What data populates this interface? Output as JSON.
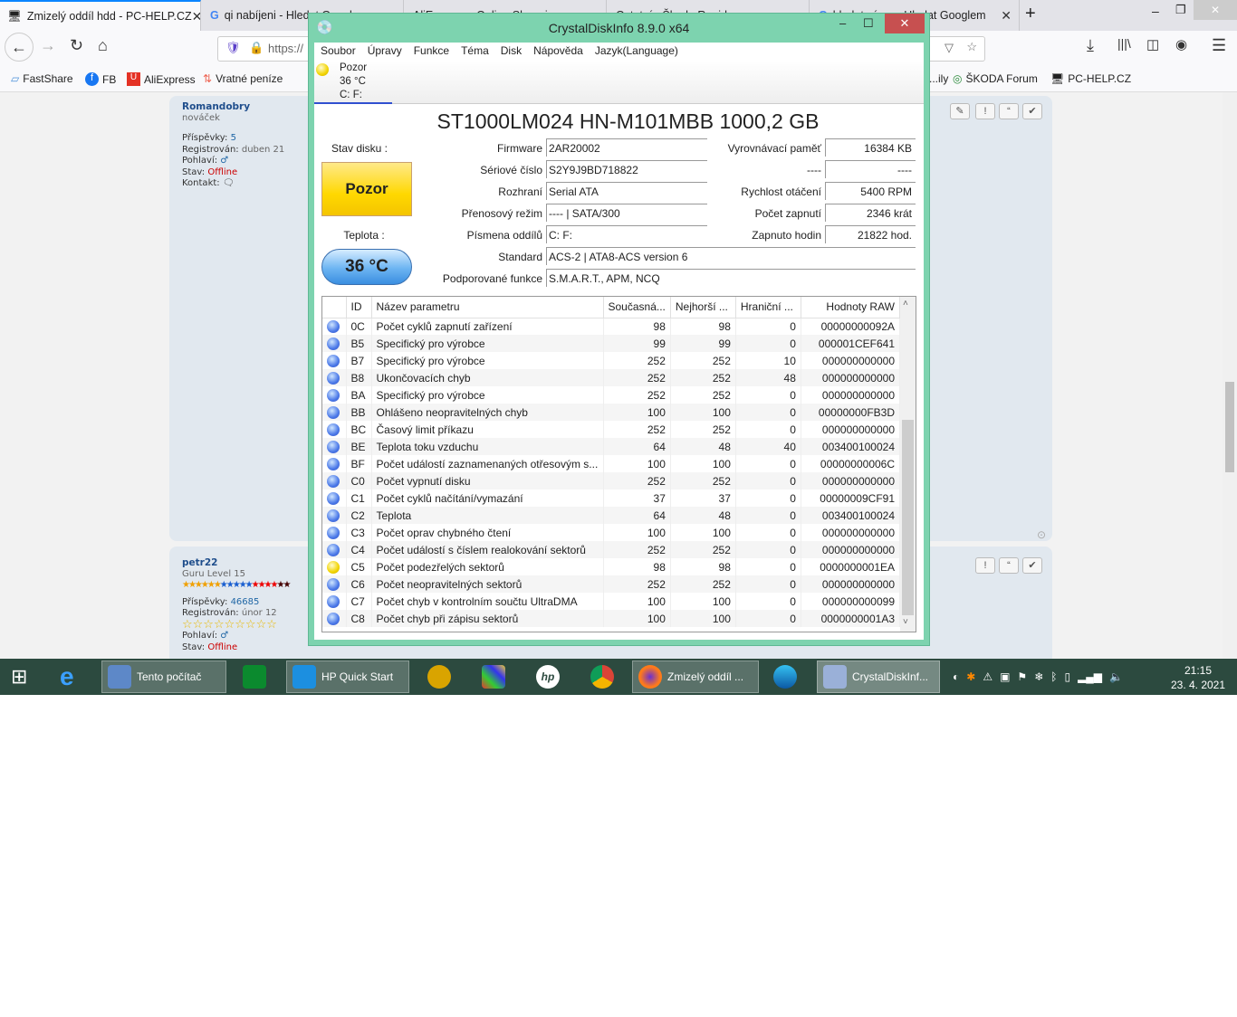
{
  "browser": {
    "tabs": [
      {
        "label": "Zmizelý oddíl hdd - PC-HELP.CZ",
        "active": true
      },
      {
        "label": "qi nabíjeni - Hledat Googlem"
      },
      {
        "label": "AliExpress - Online Shopping"
      },
      {
        "label": "Ostatní - Škoda Rapid"
      },
      {
        "label": "hledat výraz - Hledat Googlem"
      }
    ],
    "url": "https://",
    "bookmarks": [
      "FastShare",
      "FB",
      "AliExpress",
      "Vratné peníze",
      "...ily",
      "ŠKODA Forum",
      "PC-HELP.CZ"
    ]
  },
  "forum": {
    "posts": [
      {
        "user": "Romandobry",
        "rank": "nováček",
        "posts_label": "Příspěvky:",
        "posts": "5",
        "reg_label": "Registrován:",
        "reg": "duben 21",
        "gender_label": "Pohlaví:",
        "status_label": "Stav:",
        "status": "Offline",
        "contact_label": "Kontakt:"
      },
      {
        "user": "petr22",
        "rank": "Guru Level 15",
        "posts_label": "Příspěvky:",
        "posts": "46685",
        "reg_label": "Registrován:",
        "reg": "únor 12",
        "gender_label": "Pohlaví:",
        "status_label": "Stav:",
        "status": "Offline"
      }
    ]
  },
  "cdi": {
    "title": "CrystalDiskInfo 8.9.0 x64",
    "menu": [
      "Soubor",
      "Úpravy",
      "Funkce",
      "Téma",
      "Disk",
      "Nápověda",
      "Jazyk(Language)"
    ],
    "drive_tab": {
      "status": "Pozor",
      "temp": "36 °C",
      "letters": "C: F:"
    },
    "model": "ST1000LM024 HN-M101MBB 1000,2 GB",
    "health_label": "Stav disku :",
    "health": "Pozor",
    "temp_label": "Teplota :",
    "temp": "36 °C",
    "left_fields": [
      {
        "label": "Firmware",
        "value": "2AR20002"
      },
      {
        "label": "Sériové číslo",
        "value": "S2Y9J9BD718822"
      },
      {
        "label": "Rozhraní",
        "value": "Serial ATA"
      },
      {
        "label": "Přenosový režim",
        "value": "---- | SATA/300"
      },
      {
        "label": "Písmena oddílů",
        "value": "C: F:"
      }
    ],
    "right_fields": [
      {
        "label": "Vyrovnávací paměť",
        "value": "16384 KB"
      },
      {
        "label": "----",
        "value": "----"
      },
      {
        "label": "Rychlost otáčení",
        "value": "5400 RPM"
      },
      {
        "label": "Počet zapnutí",
        "value": "2346 krát"
      },
      {
        "label": "Zapnuto hodin",
        "value": "21822 hod."
      }
    ],
    "wide_fields": [
      {
        "label": "Standard",
        "value": "ACS-2 | ATA8-ACS version 6"
      },
      {
        "label": "Podporované funkce",
        "value": "S.M.A.R.T., APM, NCQ"
      }
    ],
    "columns": [
      "ID",
      "Název parametru",
      "Současná...",
      "Nejhorší ...",
      "Hraniční ...",
      "Hodnoty RAW"
    ],
    "rows": [
      [
        "0C",
        "Počet cyklů zapnutí zařízení",
        "98",
        "98",
        "0",
        "00000000092A",
        "ok"
      ],
      [
        "B5",
        "Specifický pro výrobce",
        "99",
        "99",
        "0",
        "000001CEF641",
        "ok"
      ],
      [
        "B7",
        "Specifický pro výrobce",
        "252",
        "252",
        "10",
        "000000000000",
        "ok"
      ],
      [
        "B8",
        "Ukončovacích chyb",
        "252",
        "252",
        "48",
        "000000000000",
        "ok"
      ],
      [
        "BA",
        "Specifický pro výrobce",
        "252",
        "252",
        "0",
        "000000000000",
        "ok"
      ],
      [
        "BB",
        "Ohlášeno neopravitelných chyb",
        "100",
        "100",
        "0",
        "00000000FB3D",
        "ok"
      ],
      [
        "BC",
        "Časový limit příkazu",
        "252",
        "252",
        "0",
        "000000000000",
        "ok"
      ],
      [
        "BE",
        "Teplota toku vzduchu",
        "64",
        "48",
        "40",
        "003400100024",
        "ok"
      ],
      [
        "BF",
        "Počet událostí zaznamenaných otřesovým s...",
        "100",
        "100",
        "0",
        "00000000006C",
        "ok"
      ],
      [
        "C0",
        "Počet vypnutí disku",
        "252",
        "252",
        "0",
        "000000000000",
        "ok"
      ],
      [
        "C1",
        "Počet cyklů načítání/vymazání",
        "37",
        "37",
        "0",
        "00000009CF91",
        "ok"
      ],
      [
        "C2",
        "Teplota",
        "64",
        "48",
        "0",
        "003400100024",
        "ok"
      ],
      [
        "C3",
        "Počet oprav chybného čtení",
        "100",
        "100",
        "0",
        "000000000000",
        "ok"
      ],
      [
        "C4",
        "Počet událostí s číslem realokování sektorů",
        "252",
        "252",
        "0",
        "000000000000",
        "ok"
      ],
      [
        "C5",
        "Počet podezřelých sektorů",
        "98",
        "98",
        "0",
        "0000000001EA",
        "warn"
      ],
      [
        "C6",
        "Počet neopravitelných sektorů",
        "252",
        "252",
        "0",
        "000000000000",
        "ok"
      ],
      [
        "C7",
        "Počet chyb v kontrolním součtu UltraDMA",
        "100",
        "100",
        "0",
        "000000000099",
        "ok"
      ],
      [
        "C8",
        "Počet chyb při zápisu sektorů",
        "100",
        "100",
        "0",
        "0000000001A3",
        "ok"
      ]
    ],
    "colors": {
      "good": "#4a78e8",
      "caution": "#f2d400",
      "frame": "#7dd3af"
    }
  },
  "taskbar": {
    "items": [
      "Tento počítač",
      "HP Quick Start",
      "Zmizelý oddíl ...",
      "CrystalDiskInf..."
    ],
    "time": "21:15",
    "date": "23. 4. 2021"
  }
}
